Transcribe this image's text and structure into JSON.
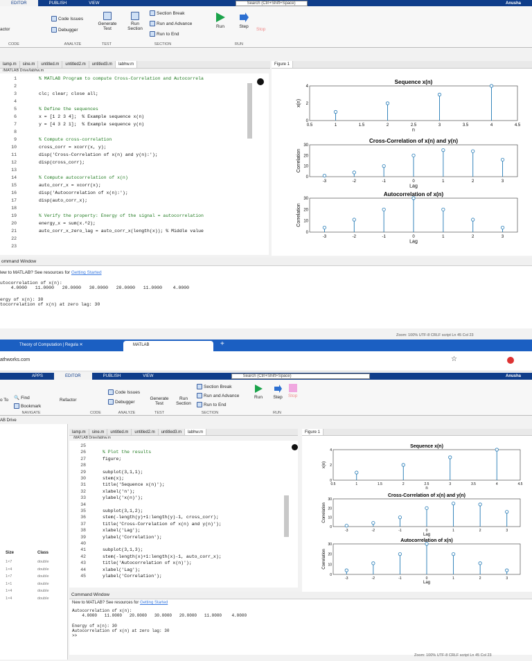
{
  "top": {
    "tabs": [
      "EDITOR",
      "PUBLISH",
      "VIEW"
    ],
    "search_placeholder": "Search (Ctrl+Shift+Space)",
    "user": "Anusha"
  },
  "ribbon": {
    "refactor": "actor",
    "code_issues": "Code Issues",
    "debugger": "Debugger",
    "generate_test": "Generate Test",
    "run_section": "Run Section",
    "section_break": "Section Break",
    "run_and_advance": "Run and Advance",
    "run_to_end": "Run to End",
    "run": "Run",
    "step": "Step",
    "stop": "Stop",
    "sections": [
      "CODE",
      "ANALYZE",
      "TEST",
      "SECTION",
      "RUN"
    ]
  },
  "ribbon2": {
    "find": "Find",
    "bookmark": "Bookmark",
    "goto": "o To",
    "refactor": "Refactor",
    "navigate": "NAVIGATE",
    "tabs": [
      "APPS",
      "EDITOR",
      "PUBLISH",
      "VIEW"
    ],
    "user": "Anusha"
  },
  "editor": {
    "tabs": [
      "lamp.m",
      "sine.m",
      "untitled.m",
      "untitled2.m",
      "untitled3.m",
      "labhw.m"
    ],
    "path": "/MATLAB Drive/labhw.m",
    "path2": "/MATLAB Drive/labhw.m",
    "lines1": [
      {
        "n": "1",
        "t": "% MATLAB Program to compute Cross-Correlation and Autocorrela",
        "c": "cmt"
      },
      {
        "n": "2",
        "t": "",
        "c": ""
      },
      {
        "n": "3",
        "t": "clc; clear; close all;",
        "c": ""
      },
      {
        "n": "4",
        "t": "",
        "c": ""
      },
      {
        "n": "5",
        "t": "% Define the sequences",
        "c": "cmt"
      },
      {
        "n": "6",
        "t": "x = [1 2 3 4];  % Example sequence x(n)",
        "c": ""
      },
      {
        "n": "7",
        "t": "y = [4 3 2 1];  % Example sequence y(n)",
        "c": ""
      },
      {
        "n": "8",
        "t": "",
        "c": ""
      },
      {
        "n": "9",
        "t": "% Compute cross-correlation",
        "c": "cmt"
      },
      {
        "n": "10",
        "t": "cross_corr = xcorr(x, y);",
        "c": ""
      },
      {
        "n": "11",
        "t": "disp('Cross-Correlation of x(n) and y(n):');",
        "c": ""
      },
      {
        "n": "12",
        "t": "disp(cross_corr);",
        "c": ""
      },
      {
        "n": "13",
        "t": "",
        "c": ""
      },
      {
        "n": "14",
        "t": "% Compute autocorrelation of x(n)",
        "c": "cmt"
      },
      {
        "n": "15",
        "t": "auto_corr_x = xcorr(x);",
        "c": ""
      },
      {
        "n": "16",
        "t": "disp('Autocorrelation of x(n):');",
        "c": ""
      },
      {
        "n": "17",
        "t": "disp(auto_corr_x);",
        "c": ""
      },
      {
        "n": "18",
        "t": "",
        "c": ""
      },
      {
        "n": "19",
        "t": "% Verify the property: Energy of the signal = autocorrelation",
        "c": "cmt"
      },
      {
        "n": "20",
        "t": "energy_x = sum(x.^2);",
        "c": ""
      },
      {
        "n": "21",
        "t": "auto_corr_x_zero_lag = auto_corr_x(length(x)); % Middle value",
        "c": ""
      },
      {
        "n": "22",
        "t": "",
        "c": ""
      },
      {
        "n": "23",
        "t": "",
        "c": ""
      }
    ],
    "lines2": [
      {
        "n": "25",
        "t": "",
        "c": ""
      },
      {
        "n": "26",
        "t": "% Plot the results",
        "c": "cmt"
      },
      {
        "n": "27",
        "t": "figure;",
        "c": ""
      },
      {
        "n": "28",
        "t": "",
        "c": ""
      },
      {
        "n": "29",
        "t": "subplot(3,1,1);",
        "c": ""
      },
      {
        "n": "30",
        "t": "stem(x);",
        "c": ""
      },
      {
        "n": "31",
        "t": "title('Sequence x(n)');",
        "c": ""
      },
      {
        "n": "32",
        "t": "xlabel('n');",
        "c": ""
      },
      {
        "n": "33",
        "t": "ylabel('x(n)');",
        "c": ""
      },
      {
        "n": "34",
        "t": "",
        "c": ""
      },
      {
        "n": "35",
        "t": "subplot(3,1,2);",
        "c": ""
      },
      {
        "n": "36",
        "t": "stem(-length(y)+1:length(y)-1, cross_corr);",
        "c": ""
      },
      {
        "n": "37",
        "t": "title('Cross-Correlation of x(n) and y(n)');",
        "c": ""
      },
      {
        "n": "38",
        "t": "xlabel('Lag');",
        "c": ""
      },
      {
        "n": "39",
        "t": "ylabel('Correlation');",
        "c": ""
      },
      {
        "n": "40",
        "t": "",
        "c": ""
      },
      {
        "n": "41",
        "t": "subplot(3,1,3);",
        "c": ""
      },
      {
        "n": "42",
        "t": "stem(-length(x)+1:length(x)-1, auto_corr_x);",
        "c": ""
      },
      {
        "n": "43",
        "t": "title('Autocorrelation of x(n)');",
        "c": ""
      },
      {
        "n": "44",
        "t": "xlabel('Lag');",
        "c": ""
      },
      {
        "n": "45",
        "t": "ylabel('Correlation');",
        "c": ""
      }
    ]
  },
  "command_window": {
    "title": "Command Window",
    "new_to": "New to MATLAB? See resources for ",
    "link": "Getting Started",
    "l1": "Autocorrelation of x(n):",
    "l2": "    4.0000   11.0000   20.0000   30.0000   20.0000   11.0000    4.0000",
    "l3": "Energy of x(n): 30",
    "l4": "Autocorrelation of x(n) at zero lag: 30",
    "prompt": ">>",
    "top_l1": "utocorrelation of x(n):",
    "top_l3": "ergy of x(n): 30",
    "top_l4": "tocorrelation of x(n) at zero lag: 30",
    "top_title": "ommand Window",
    "top_new": "lew to MATLAB? See resources for "
  },
  "status": "Zoom: 100%   UTF-8   CRLF   script   Ln 45  Col 23",
  "workspace": {
    "size": "Size",
    "class": "Class",
    "rows": [
      [
        "1×7",
        "double"
      ],
      [
        "1×4",
        "double"
      ],
      [
        "1×7",
        "double"
      ],
      [
        "1×1",
        "double"
      ],
      [
        "1×4",
        "double"
      ],
      [
        "1×4",
        "double"
      ]
    ],
    "drive": "AB Drive"
  },
  "browser": {
    "tab1": "Theory of Computation | Regula",
    "tab2": "MATLAB",
    "url": "athworks.com"
  },
  "figure": {
    "tab": "Figure 1"
  },
  "chart_data": [
    {
      "type": "bar",
      "title": "Sequence x(n)",
      "xlabel": "n",
      "ylabel": "x(n)",
      "x": [
        1,
        2,
        3,
        4
      ],
      "values": [
        1,
        2,
        3,
        4
      ],
      "xlim": [
        0.5,
        4.5
      ],
      "ylim": [
        0,
        4
      ],
      "xticks": [
        "0.5",
        "1",
        "1.5",
        "2",
        "2.5",
        "3",
        "3.5",
        "4",
        "4.5"
      ],
      "yticks": [
        "0",
        "2",
        "4"
      ]
    },
    {
      "type": "bar",
      "title": "Cross-Correlation of x(n) and y(n)",
      "xlabel": "Lag",
      "ylabel": "Correlation",
      "x": [
        -3,
        -2,
        -1,
        0,
        1,
        2,
        3
      ],
      "values": [
        1,
        4,
        10,
        20,
        25,
        24,
        16
      ],
      "xlim": [
        -3.5,
        3.5
      ],
      "ylim": [
        0,
        30
      ],
      "xticks": [
        "-3",
        "-2",
        "-1",
        "0",
        "1",
        "2",
        "3"
      ],
      "yticks": [
        "0",
        "10",
        "20",
        "30"
      ]
    },
    {
      "type": "bar",
      "title": "Autocorrelation of x(n)",
      "xlabel": "Lag",
      "ylabel": "Correlation",
      "x": [
        -3,
        -2,
        -1,
        0,
        1,
        2,
        3
      ],
      "values": [
        4,
        11,
        20,
        30,
        20,
        11,
        4
      ],
      "xlim": [
        -3.5,
        3.5
      ],
      "ylim": [
        0,
        30
      ],
      "xticks": [
        "-3",
        "-2",
        "-1",
        "0",
        "1",
        "2",
        "3"
      ],
      "yticks": [
        "0",
        "10",
        "20",
        "30"
      ]
    }
  ]
}
